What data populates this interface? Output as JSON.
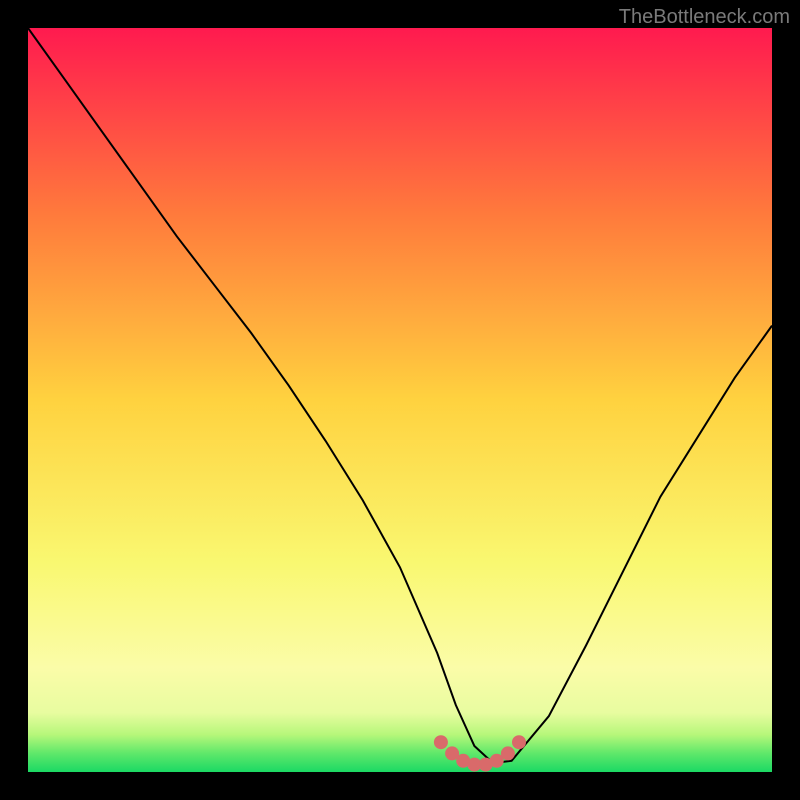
{
  "watermark": "TheBottleneck.com",
  "chart_data": {
    "type": "line",
    "title": "",
    "xlabel": "",
    "ylabel": "",
    "xlim": [
      0,
      1
    ],
    "ylim": [
      0,
      1
    ],
    "series": [
      {
        "name": "bottleneck-curve",
        "x": [
          0.0,
          0.05,
          0.1,
          0.15,
          0.2,
          0.25,
          0.3,
          0.35,
          0.4,
          0.45,
          0.5,
          0.55,
          0.575,
          0.6,
          0.625,
          0.65,
          0.7,
          0.75,
          0.8,
          0.85,
          0.9,
          0.95,
          1.0
        ],
        "y": [
          1.0,
          0.93,
          0.86,
          0.79,
          0.72,
          0.655,
          0.59,
          0.52,
          0.445,
          0.365,
          0.275,
          0.16,
          0.09,
          0.035,
          0.012,
          0.015,
          0.075,
          0.17,
          0.27,
          0.37,
          0.45,
          0.53,
          0.6
        ],
        "color": "#000000"
      },
      {
        "name": "optimal-range-markers",
        "x": [
          0.555,
          0.57,
          0.585,
          0.6,
          0.615,
          0.63,
          0.645,
          0.66
        ],
        "y": [
          0.04,
          0.025,
          0.015,
          0.01,
          0.01,
          0.015,
          0.025,
          0.04
        ],
        "color": "#d96a6a"
      }
    ],
    "background_gradient": {
      "stops": [
        {
          "offset": 0.0,
          "color": "#ff1a4f"
        },
        {
          "offset": 0.25,
          "color": "#ff7a3c"
        },
        {
          "offset": 0.5,
          "color": "#ffd23f"
        },
        {
          "offset": 0.72,
          "color": "#f9f871"
        },
        {
          "offset": 0.86,
          "color": "#fbfca8"
        },
        {
          "offset": 0.92,
          "color": "#e8fca0"
        },
        {
          "offset": 0.95,
          "color": "#b6f77a"
        },
        {
          "offset": 0.975,
          "color": "#5fe86a"
        },
        {
          "offset": 1.0,
          "color": "#1bd964"
        }
      ]
    }
  }
}
